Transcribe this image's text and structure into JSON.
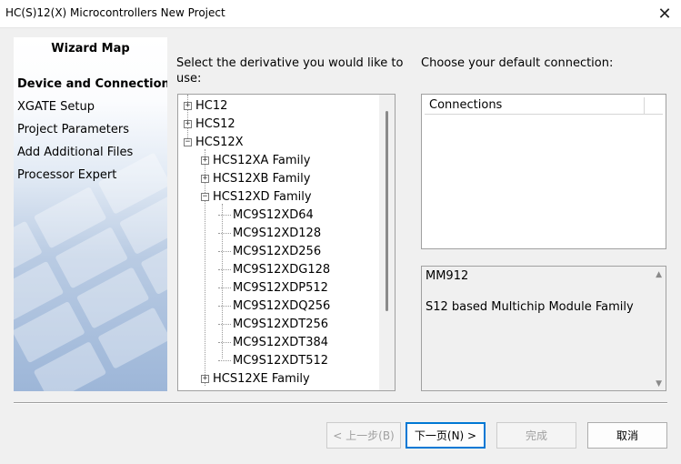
{
  "window": {
    "title": "HC(S)12(X) Microcontrollers New Project",
    "close_glyph": "✕"
  },
  "wizard_map": {
    "title": "Wizard Map",
    "items": [
      {
        "label": "Device and Connection",
        "active": true
      },
      {
        "label": "XGATE Setup",
        "active": false
      },
      {
        "label": "Project Parameters",
        "active": false
      },
      {
        "label": "Add Additional Files",
        "active": false
      },
      {
        "label": "Processor Expert",
        "active": false
      }
    ]
  },
  "derivative": {
    "label_line1": "Select the derivative you would like to",
    "label_line2": "use:",
    "tree": [
      {
        "label": "HC12",
        "level": 0,
        "expander": "+"
      },
      {
        "label": "HCS12",
        "level": 0,
        "expander": "+"
      },
      {
        "label": "HCS12X",
        "level": 0,
        "expander": "−"
      },
      {
        "label": "HCS12XA Family",
        "level": 1,
        "expander": "+"
      },
      {
        "label": "HCS12XB Family",
        "level": 1,
        "expander": "+"
      },
      {
        "label": "HCS12XD Family",
        "level": 1,
        "expander": "−"
      },
      {
        "label": "MC9S12XD64",
        "level": 2,
        "expander": ""
      },
      {
        "label": "MC9S12XD128",
        "level": 2,
        "expander": ""
      },
      {
        "label": "MC9S12XD256",
        "level": 2,
        "expander": ""
      },
      {
        "label": "MC9S12XDG128",
        "level": 2,
        "expander": ""
      },
      {
        "label": "MC9S12XDP512",
        "level": 2,
        "expander": ""
      },
      {
        "label": "MC9S12XDQ256",
        "level": 2,
        "expander": ""
      },
      {
        "label": "MC9S12XDT256",
        "level": 2,
        "expander": ""
      },
      {
        "label": "MC9S12XDT384",
        "level": 2,
        "expander": ""
      },
      {
        "label": "MC9S12XDT512",
        "level": 2,
        "expander": ""
      },
      {
        "label": "HCS12XE Family",
        "level": 1,
        "expander": "+"
      }
    ]
  },
  "connection": {
    "label": "Choose your default connection:",
    "column_header": "Connections"
  },
  "description": {
    "line1": "MM912",
    "line2": "S12 based Multichip Module Family",
    "scroll_up_glyph": "▲",
    "scroll_down_glyph": "▼"
  },
  "buttons": {
    "back": "< 上一步(B)",
    "next": "下一页(N) >",
    "finish": "完成",
    "cancel": "取消"
  },
  "colors": {
    "accent": "#0078d4",
    "window_bg": "#f0f0f0"
  }
}
